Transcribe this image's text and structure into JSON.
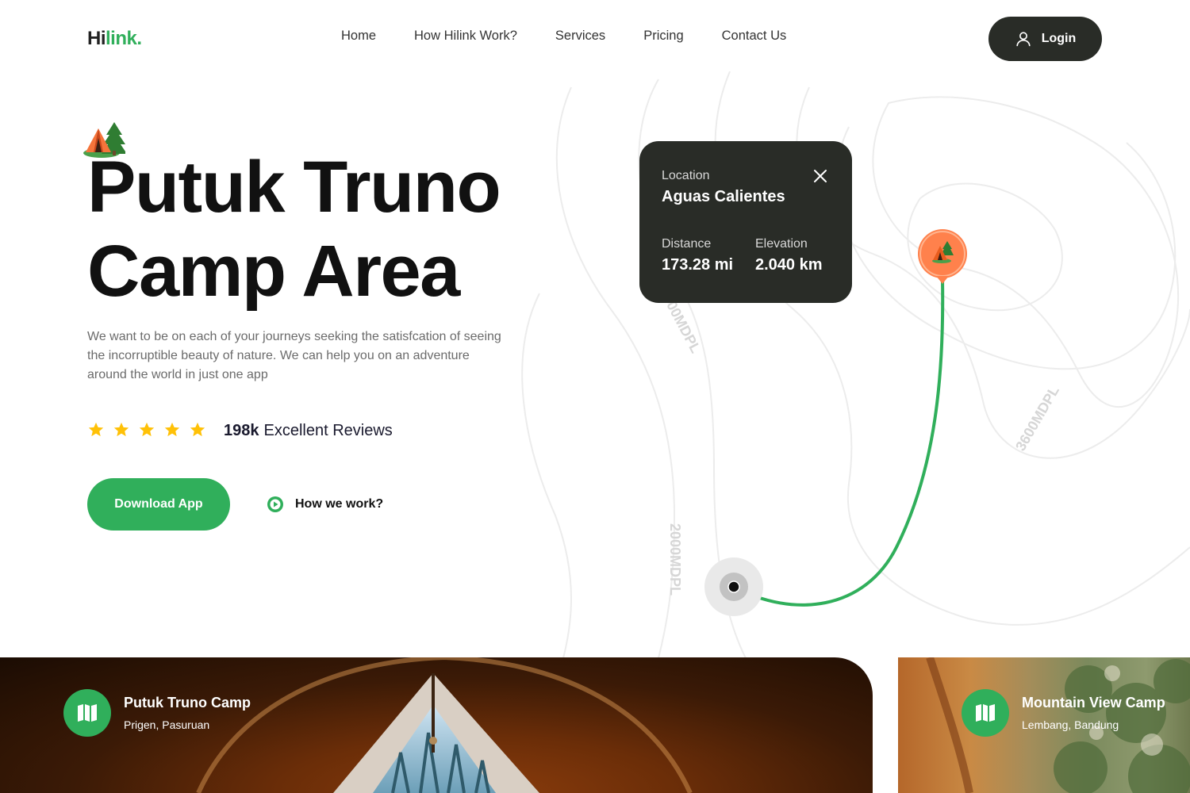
{
  "brand": {
    "logo_part1": "Hi",
    "logo_part2": "link.",
    "accent": "#30AF5B",
    "dark": "#292C27"
  },
  "nav": {
    "items": [
      {
        "label": "Home"
      },
      {
        "label": "How Hilink Work?"
      },
      {
        "label": "Services"
      },
      {
        "label": "Pricing"
      },
      {
        "label": "Contact Us"
      }
    ],
    "login_label": "Login",
    "login_icon": "user-icon"
  },
  "hero": {
    "badge_icon": "camping-tent-icon",
    "title_line1": "Putuk Truno",
    "title_line2": "Camp Area",
    "description": "We want to be on each of your journeys seeking the satisfcation of seeing the incorruptible beauty of nature. We can help you on an adventure around the world in just one app",
    "rating": {
      "stars": 5,
      "count": "198k",
      "label": "Excellent Reviews"
    },
    "download_label": "Download App",
    "how_label": "How we work?"
  },
  "map": {
    "contour_labels": [
      "400MDPL",
      "3600MDPL",
      "2000MDPL"
    ],
    "card": {
      "location_label": "Location",
      "location_value": "Aguas Calientes",
      "distance_label": "Distance",
      "distance_value": "173.28 mi",
      "elevation_label": "Elevation",
      "elevation_value": "2.040 km"
    },
    "route_color": "#30AF5B",
    "pin_color": "#FF814C"
  },
  "camps": [
    {
      "title": "Putuk Truno Camp",
      "subtitle": "Prigen, Pasuruan",
      "icon": "map-icon"
    },
    {
      "title": "Mountain View Camp",
      "subtitle": "Lembang, Bandung",
      "icon": "map-icon"
    }
  ]
}
